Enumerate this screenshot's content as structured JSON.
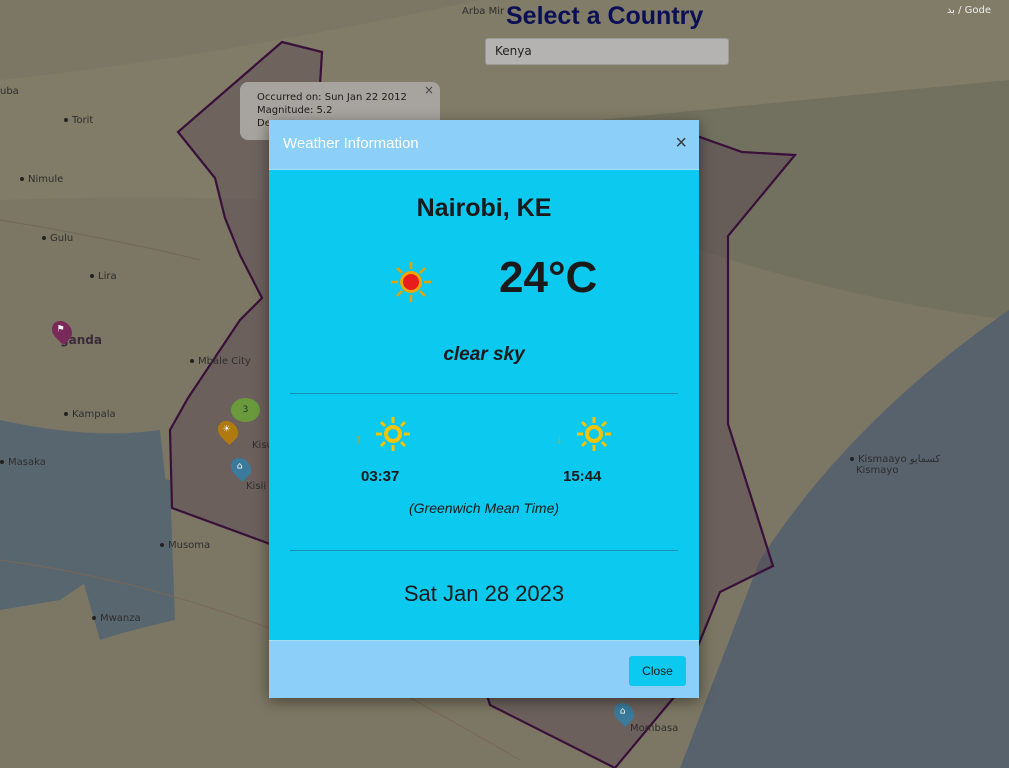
{
  "header": {
    "title": "Select a Country",
    "country_value": "Kenya",
    "attribution": "بد / Gode"
  },
  "map_labels": [
    {
      "name": "Arba Minch",
      "text": "Arba Mir"
    },
    {
      "name": "Juba",
      "text": "uba"
    },
    {
      "name": "Torit",
      "text": "Torit"
    },
    {
      "name": "Nimule",
      "text": "Nimule"
    },
    {
      "name": "Gulu",
      "text": "Gulu"
    },
    {
      "name": "Lira",
      "text": "Lira"
    },
    {
      "name": "Uganda",
      "text": "ganda"
    },
    {
      "name": "Mbale",
      "text": "Mbale City"
    },
    {
      "name": "Kampala",
      "text": "Kampala"
    },
    {
      "name": "Kisumu",
      "text": "Kisum"
    },
    {
      "name": "Kisii",
      "text": "Kisii"
    },
    {
      "name": "Masaka",
      "text": "Masaka"
    },
    {
      "name": "Musoma",
      "text": "Musoma"
    },
    {
      "name": "Mwanza",
      "text": "Mwanza"
    },
    {
      "name": "Kismaayo",
      "text": "Kismaayo كسمايو"
    },
    {
      "name": "Kismayo",
      "text": "Kismayo"
    },
    {
      "name": "Mombasa",
      "text": "Mombasa"
    }
  ],
  "popup": {
    "line1": "Occurred on: Sun Jan 22 2012",
    "line2": "Magnitude: 5.2",
    "line3": "De",
    "close": "×"
  },
  "cluster_count": "3",
  "modal": {
    "title": "Weather Information",
    "close_x": "×",
    "city": "Nairobi, KE",
    "temperature": "24°C",
    "description": "clear sky",
    "sunrise": "03:37",
    "sunset": "15:44",
    "timezone": "(Greenwich Mean Time)",
    "date": "Sat Jan 28 2023",
    "close_button": "Close",
    "icons": {
      "weather": "sun-icon",
      "sunrise": "sunrise-icon",
      "sunset": "sunset-icon"
    }
  },
  "colors": {
    "modal_body": "#0bc9ef",
    "modal_header": "#8ccff8",
    "border_line": "#5c1a5c"
  }
}
